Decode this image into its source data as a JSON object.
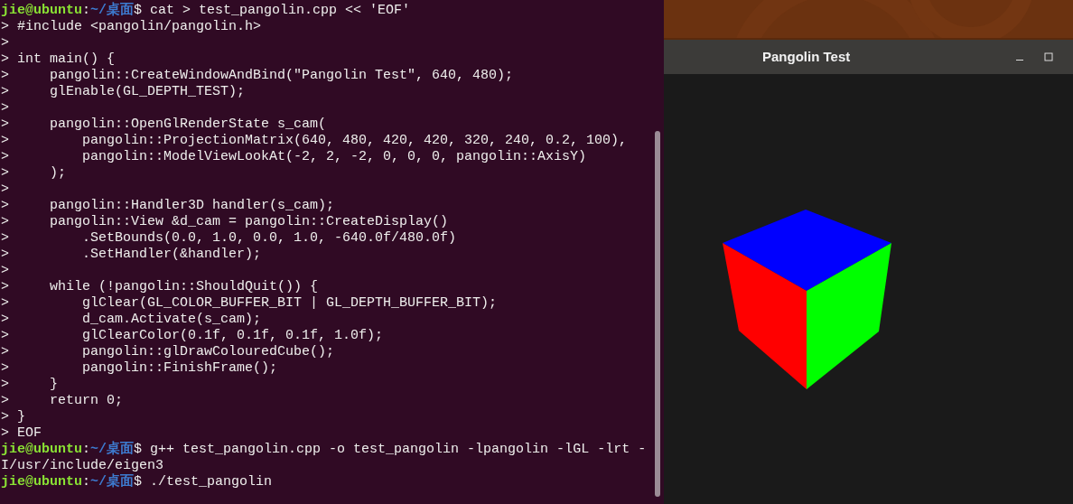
{
  "terminal": {
    "lines": [
      {
        "kind": "prompt",
        "user": "jie@ubuntu",
        "separator": ":",
        "path": "~/桌面",
        "command": "$ cat > test_pangolin.cpp << 'EOF'"
      },
      {
        "kind": "text",
        "text": "> #include <pangolin/pangolin.h>"
      },
      {
        "kind": "text",
        "text": ">"
      },
      {
        "kind": "text",
        "text": "> int main() {"
      },
      {
        "kind": "text",
        "text": ">     pangolin::CreateWindowAndBind(\"Pangolin Test\", 640, 480);"
      },
      {
        "kind": "text",
        "text": ">     glEnable(GL_DEPTH_TEST);"
      },
      {
        "kind": "text",
        "text": ">"
      },
      {
        "kind": "text",
        "text": ">     pangolin::OpenGlRenderState s_cam("
      },
      {
        "kind": "text",
        "text": ">         pangolin::ProjectionMatrix(640, 480, 420, 420, 320, 240, 0.2, 100),"
      },
      {
        "kind": "text",
        "text": ">         pangolin::ModelViewLookAt(-2, 2, -2, 0, 0, 0, pangolin::AxisY)"
      },
      {
        "kind": "text",
        "text": ">     );"
      },
      {
        "kind": "text",
        "text": ">"
      },
      {
        "kind": "text",
        "text": ">     pangolin::Handler3D handler(s_cam);"
      },
      {
        "kind": "text",
        "text": ">     pangolin::View &d_cam = pangolin::CreateDisplay()"
      },
      {
        "kind": "text",
        "text": ">         .SetBounds(0.0, 1.0, 0.0, 1.0, -640.0f/480.0f)"
      },
      {
        "kind": "text",
        "text": ">         .SetHandler(&handler);"
      },
      {
        "kind": "text",
        "text": ">"
      },
      {
        "kind": "text",
        "text": ">     while (!pangolin::ShouldQuit()) {"
      },
      {
        "kind": "text",
        "text": ">         glClear(GL_COLOR_BUFFER_BIT | GL_DEPTH_BUFFER_BIT);"
      },
      {
        "kind": "text",
        "text": ">         d_cam.Activate(s_cam);"
      },
      {
        "kind": "text",
        "text": ">         glClearColor(0.1f, 0.1f, 0.1f, 1.0f);"
      },
      {
        "kind": "text",
        "text": ">         pangolin::glDrawColouredCube();"
      },
      {
        "kind": "text",
        "text": ">         pangolin::FinishFrame();"
      },
      {
        "kind": "text",
        "text": ">     }"
      },
      {
        "kind": "text",
        "text": ">     return 0;"
      },
      {
        "kind": "text",
        "text": "> }"
      },
      {
        "kind": "text",
        "text": "> EOF"
      },
      {
        "kind": "prompt",
        "user": "jie@ubuntu",
        "separator": ":",
        "path": "~/桌面",
        "command": "$ g++ test_pangolin.cpp -o test_pangolin -lpangolin -lGL -lrt -"
      },
      {
        "kind": "text",
        "text": "I/usr/include/eigen3"
      },
      {
        "kind": "prompt",
        "user": "jie@ubuntu",
        "separator": ":",
        "path": "~/桌面",
        "command": "$ ./test_pangolin"
      }
    ]
  },
  "window": {
    "title": "Pangolin Test"
  }
}
